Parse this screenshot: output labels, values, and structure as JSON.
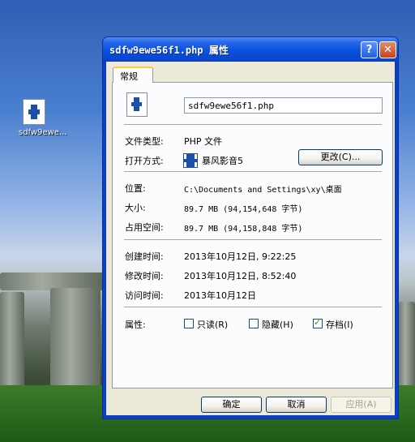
{
  "desktop": {
    "icon_label": "sdfw9ewe..."
  },
  "window": {
    "title": "sdfw9ewe56f1.php 属性"
  },
  "tab": {
    "label": "常规"
  },
  "general": {
    "filename": "sdfw9ewe56f1.php",
    "file_type_label": "文件类型:",
    "file_type_value": "PHP 文件",
    "open_with_label": "打开方式:",
    "open_with_value": "暴风影音5",
    "change_button": "更改(C)...",
    "location_label": "位置:",
    "location_value": "C:\\Documents and Settings\\xy\\桌面",
    "size_label": "大小:",
    "size_value": "89.7 MB (94,154,648 字节)",
    "size_on_disk_label": "占用空间:",
    "size_on_disk_value": "89.7 MB (94,158,848 字节)",
    "created_label": "创建时间:",
    "created_value": "2013年10月12日, 9:22:25",
    "modified_label": "修改时间:",
    "modified_value": "2013年10月12日, 8:52:40",
    "accessed_label": "访问时间:",
    "accessed_value": "2013年10月12日",
    "attributes_label": "属性:",
    "attr_readonly": "只读(R)",
    "attr_hidden": "隐藏(H)",
    "attr_archive": "存档(I)",
    "attr_readonly_checked": false,
    "attr_hidden_checked": false,
    "attr_archive_checked": true
  },
  "buttons": {
    "ok": "确定",
    "cancel": "取消",
    "apply": "应用(A)"
  }
}
